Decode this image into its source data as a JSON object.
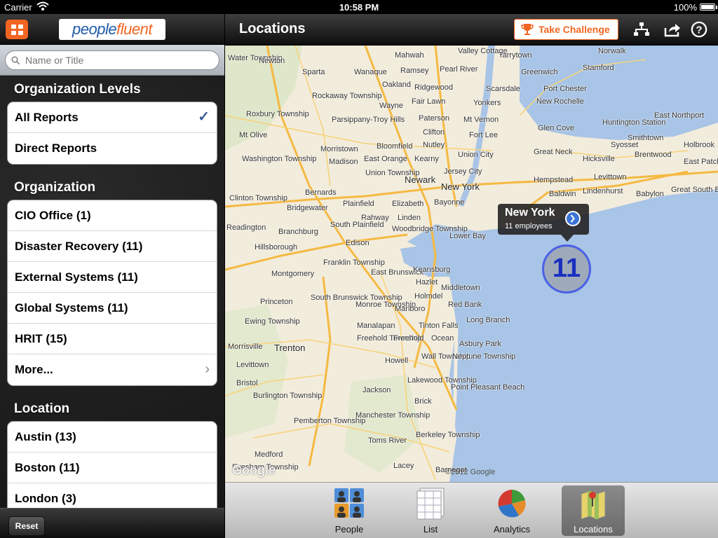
{
  "status_bar": {
    "carrier": "Carrier",
    "time": "10:58 PM",
    "battery": "100%"
  },
  "left": {
    "logo_text_1": "people",
    "logo_text_2": "fluent",
    "search_placeholder": "Name or Title",
    "sections": [
      {
        "title": "Organization Levels",
        "items": [
          {
            "label": "All Reports",
            "checked": true
          },
          {
            "label": "Direct Reports"
          }
        ]
      },
      {
        "title": "Organization",
        "items": [
          {
            "label": "CIO Office (1)"
          },
          {
            "label": "Disaster Recovery (11)"
          },
          {
            "label": "External Systems (11)"
          },
          {
            "label": "Global Systems (11)"
          },
          {
            "label": "HRIT (15)"
          },
          {
            "label": "More...",
            "chevron": true
          }
        ]
      },
      {
        "title": "Location",
        "items": [
          {
            "label": "Austin (13)"
          },
          {
            "label": "Boston (11)"
          },
          {
            "label": "London (3)"
          }
        ]
      }
    ],
    "reset_label": "Reset"
  },
  "right": {
    "title": "Locations",
    "challenge_label": "Take Challenge",
    "icons": [
      "org-chart-icon",
      "share-icon",
      "help-icon"
    ]
  },
  "map": {
    "callout_title": "New York",
    "callout_subtitle": "11 employees",
    "cluster_count": "11",
    "google_mark": "Google",
    "copyright": "©2012 Google",
    "labels": [
      "Water Township",
      "Newton",
      "Mahwah",
      "Valley Cottage",
      "Tarrytown",
      "Norwalk",
      "Sparta",
      "Wanaque",
      "Ramsey",
      "Pearl River",
      "Greenwich",
      "Stamford",
      "Oakland",
      "Ridgewood",
      "Scarsdale",
      "Port Chester",
      "Rockaway Township",
      "Wayne",
      "Fair Lawn",
      "Yonkers",
      "New Rochelle",
      "East Northport",
      "Roxbury Township",
      "Parsippany-Troy Hills",
      "Paterson",
      "Mt Vernon",
      "Glen Cove",
      "Huntington Station",
      "Mt Olive",
      "Clifton",
      "Fort Lee",
      "Nutley",
      "Smithtown",
      "Washington Township",
      "Morristown",
      "Bloomfield",
      "Union City",
      "Great Neck",
      "Syosset",
      "Brentwood",
      "Holbrook",
      "Madison",
      "East Orange",
      "Kearny",
      "Hicksville",
      "East Patchogue",
      "Union Township",
      "Jersey City",
      "Hempstead",
      "Levittown",
      "Newark",
      "Bernards",
      "New York",
      "Baldwin",
      "Lindenhurst",
      "Babylon",
      "Clinton Township",
      "Plainfield",
      "Elizabeth",
      "Bayonne",
      "Great South Bay",
      "Bridgewater",
      "Rahway",
      "Linden",
      "South Plainfield",
      "Woodbridge Township",
      "Readington",
      "Branchburg",
      "Edison",
      "Lower Bay",
      "Hillsborough",
      "Franklin Township",
      "East Brunswick",
      "Keansburg",
      "Montgomery",
      "Hazlet",
      "Middletown",
      "Princeton",
      "South Brunswick Township",
      "Monroe Township",
      "Holmdel",
      "Marlboro",
      "Red Bank",
      "Long Branch",
      "Ewing Township",
      "Manalapan",
      "Tinton Falls",
      "Trenton",
      "Freehold Township",
      "Freehold",
      "Ocean",
      "Asbury Park",
      "Morrisville",
      "Levittown",
      "Howell",
      "Wall Township",
      "Neptune Township",
      "Bristol",
      "Burlington Township",
      "Lakewood Township",
      "Point Pleasant Beach",
      "Jackson",
      "Brick",
      "Pemberton Township",
      "Manchester Township",
      "Berkeley Township",
      "Toms River",
      "Medford",
      "Evesham Township",
      "Lacey",
      "Barnegat"
    ]
  },
  "tabs": [
    {
      "label": "People",
      "active": false
    },
    {
      "label": "List",
      "active": false
    },
    {
      "label": "Analytics",
      "active": false
    },
    {
      "label": "Locations",
      "active": true
    }
  ]
}
